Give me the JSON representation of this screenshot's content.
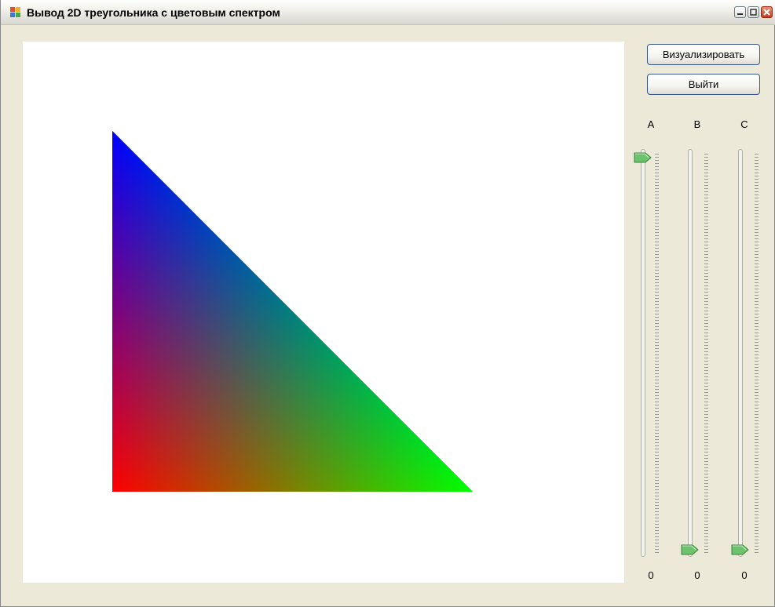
{
  "window": {
    "title": "Вывод 2D треугольника с цветовым спектром",
    "icon": "app-window-icon",
    "controls": [
      "minimize-icon",
      "maximize-icon",
      "close-icon"
    ]
  },
  "canvas": {
    "content": "gradient-triangle",
    "vertex_colors": {
      "top": "#0000ff",
      "bottom_left": "#ff0000",
      "bottom_right": "#00ff00"
    }
  },
  "buttons": {
    "visualize": "Визуализировать",
    "exit": "Выйти"
  },
  "sliders": [
    {
      "label": "A",
      "value": "0"
    },
    {
      "label": "B",
      "value": "0"
    },
    {
      "label": "C",
      "value": "0"
    }
  ],
  "colors": {
    "form_bg": "#ece9d8",
    "thumb": "#5fb35f",
    "button_border": "#3b5a8a"
  }
}
